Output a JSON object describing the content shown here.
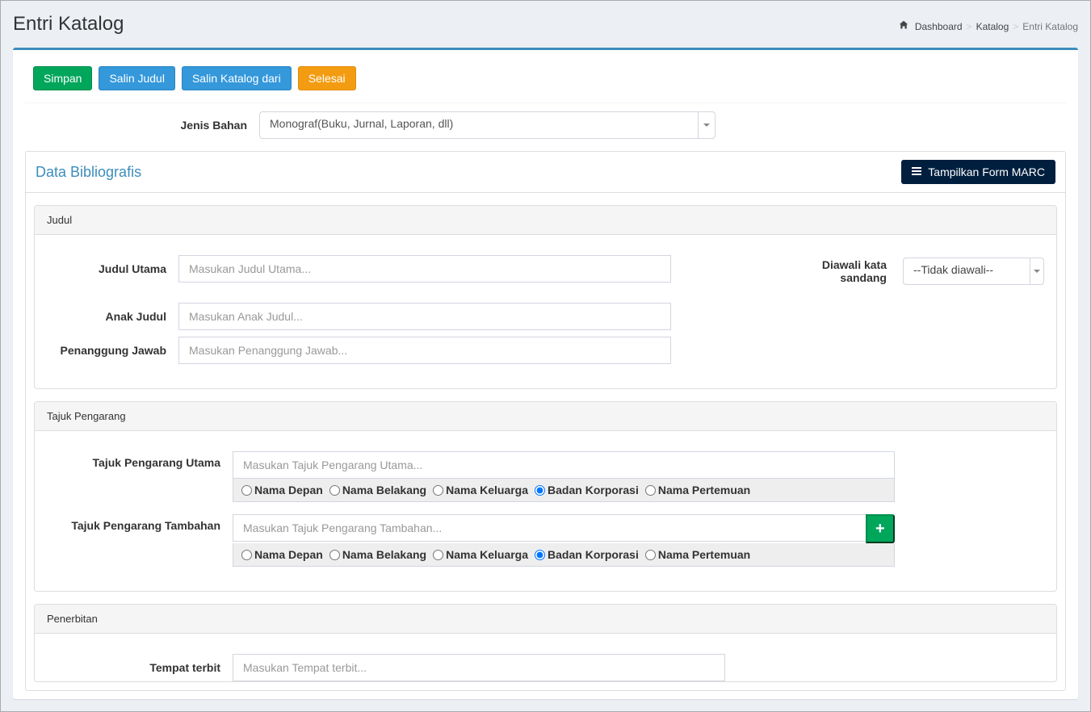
{
  "header": {
    "title": "Entri Katalog"
  },
  "breadcrumb": {
    "dashboard": "Dashboard",
    "katalog": "Katalog",
    "current": "Entri Katalog"
  },
  "actions": {
    "simpan": "Simpan",
    "salin_judul": "Salin Judul",
    "salin_katalog_dari": "Salin Katalog dari",
    "selesai": "Selesai"
  },
  "jenis_bahan": {
    "label": "Jenis Bahan",
    "value": "Monograf(Buku, Jurnal, Laporan, dll)"
  },
  "biblio": {
    "tab_title": "Data Bibliografis",
    "marc_button": "Tampilkan Form MARC"
  },
  "judul_panel": {
    "heading": "Judul",
    "judul_utama_label": "Judul Utama",
    "judul_utama_placeholder": "Masukan Judul Utama...",
    "anak_judul_label": "Anak Judul",
    "anak_judul_placeholder": "Masukan Anak Judul...",
    "penanggung_jawab_label": "Penanggung Jawab",
    "penanggung_jawab_placeholder": "Masukan Penanggung Jawab...",
    "diawali_label": "Diawali kata sandang",
    "diawali_value": "--Tidak diawali--"
  },
  "tajuk_panel": {
    "heading": "Tajuk Pengarang",
    "utama_label": "Tajuk Pengarang Utama",
    "utama_placeholder": "Masukan Tajuk Pengarang Utama...",
    "tambahan_label": "Tajuk Pengarang Tambahan",
    "tambahan_placeholder": "Masukan Tajuk Pengarang Tambahan...",
    "radios": {
      "nama_depan": "Nama Depan",
      "nama_belakang": "Nama Belakang",
      "nama_keluarga": "Nama Keluarga",
      "badan_korporasi": "Badan Korporasi",
      "nama_pertemuan": "Nama Pertemuan"
    }
  },
  "penerbitan_panel": {
    "heading": "Penerbitan",
    "tempat_label": "Tempat terbit",
    "tempat_placeholder": "Masukan Tempat terbit..."
  }
}
